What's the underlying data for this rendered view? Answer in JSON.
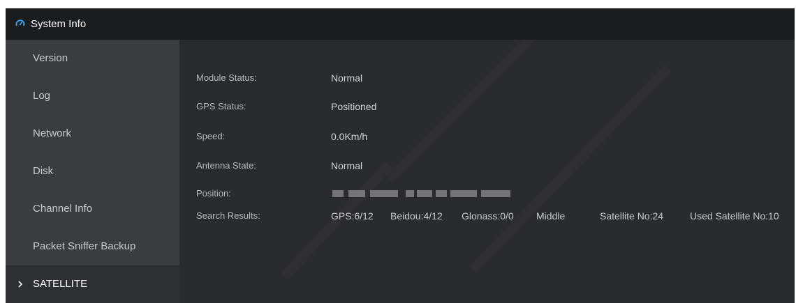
{
  "window": {
    "title": "System Info",
    "title_icon": "gauge-icon"
  },
  "sidebar": {
    "items": [
      {
        "label": "Version"
      },
      {
        "label": "Log"
      },
      {
        "label": "Network"
      },
      {
        "label": "Disk"
      },
      {
        "label": "Channel Info"
      },
      {
        "label": "Packet Sniffer Backup"
      },
      {
        "label": "SATELLITE",
        "active": true,
        "icon": "chevron-right-icon"
      }
    ]
  },
  "satellite": {
    "module_status": {
      "label": "Module Status:",
      "value": "Normal"
    },
    "gps_status": {
      "label": "GPS Status:",
      "value": "Positioned"
    },
    "speed": {
      "label": "Speed:",
      "value": "0.0Km/h"
    },
    "antenna_state": {
      "label": "Antenna State:",
      "value": "Normal"
    },
    "position": {
      "label": "Position:",
      "value_obscured": true
    },
    "search_results": {
      "label": "Search Results:",
      "gps": "GPS:6/12",
      "beidou": "Beidou:4/12",
      "glonass": "Glonass:0/0",
      "signal": "Middle",
      "satellite_no": "Satellite No:24",
      "used_satellite_no": "Used Satellite No:10"
    }
  },
  "colors": {
    "titlebar": "#1b1c1e",
    "sidebar": "#3b3c3f",
    "sidebar_active": "#2e2f32",
    "content": "#2a2b2e",
    "accent_icon": "#3ea0e8"
  }
}
